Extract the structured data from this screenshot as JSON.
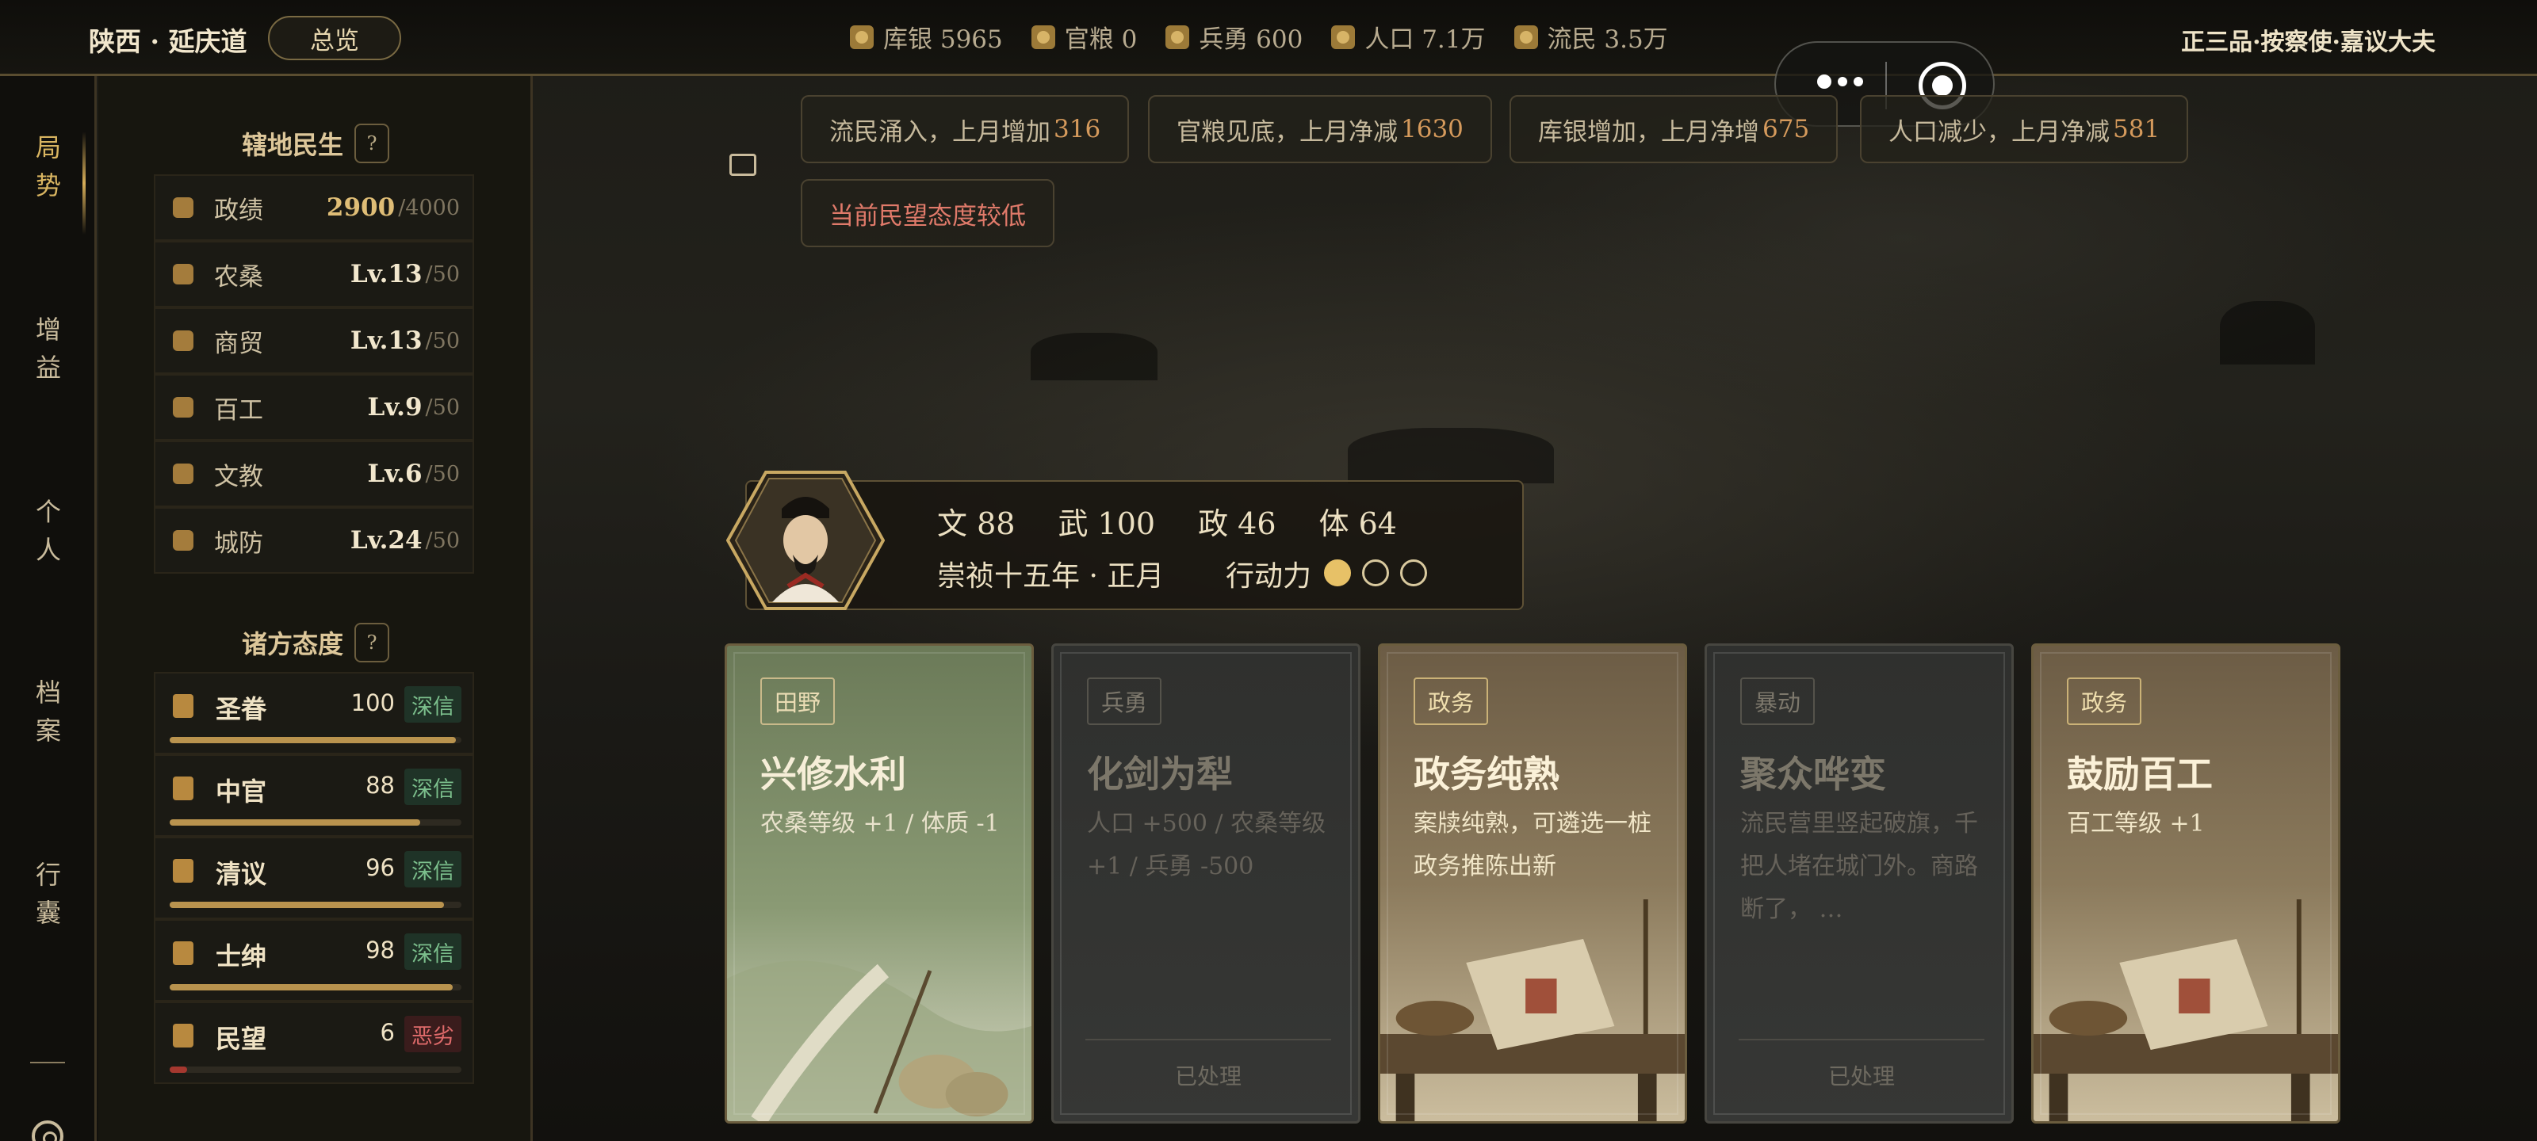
{
  "header": {
    "region": "陕西 · 延庆道",
    "overview_button": "总览",
    "rank": "正三品·按察使·嘉议大夫",
    "resources": [
      {
        "icon": "silver-icon",
        "text": "库银 5965"
      },
      {
        "icon": "grain-icon",
        "text": "官粮 0"
      },
      {
        "icon": "soldier-icon",
        "text": "兵勇 600"
      },
      {
        "icon": "population-icon",
        "text": "人口 7.1万"
      },
      {
        "icon": "refugee-icon",
        "text": "流民 3.5万"
      }
    ]
  },
  "nav": {
    "items": [
      {
        "line1": "局",
        "line2": "势",
        "active": true
      },
      {
        "line1": "增",
        "line2": "益"
      },
      {
        "line1": "个",
        "line2": "人"
      },
      {
        "line1": "档",
        "line2": "案"
      },
      {
        "line1": "行",
        "line2": "囊"
      }
    ]
  },
  "governance": {
    "title": "辖地民生",
    "help": "?",
    "stats": [
      {
        "icon": "merit-icon",
        "label": "政绩",
        "value": "2900",
        "max": "/4000"
      },
      {
        "icon": "farming-icon",
        "label": "农桑",
        "value": "Lv.13",
        "max": "/50"
      },
      {
        "icon": "trade-icon",
        "label": "商贸",
        "value": "Lv.13",
        "max": "/50"
      },
      {
        "icon": "crafts-icon",
        "label": "百工",
        "value": "Lv.9",
        "max": "/50"
      },
      {
        "icon": "education-icon",
        "label": "文教",
        "value": "Lv.6",
        "max": "/50"
      },
      {
        "icon": "defense-icon",
        "label": "城防",
        "value": "Lv.24",
        "max": "/50"
      }
    ]
  },
  "attitudes": {
    "title": "诸方态度",
    "help": "?",
    "items": [
      {
        "icon": "emperor-icon",
        "name": "圣眷",
        "value": "100",
        "badge": "深信",
        "level": 0.98,
        "tone": "good"
      },
      {
        "icon": "eunuch-icon",
        "name": "中官",
        "value": "88",
        "badge": "深信",
        "level": 0.86,
        "tone": "good"
      },
      {
        "icon": "scholar-icon",
        "name": "清议",
        "value": "96",
        "badge": "深信",
        "level": 0.94,
        "tone": "good"
      },
      {
        "icon": "gentry-icon",
        "name": "士绅",
        "value": "98",
        "badge": "深信",
        "level": 0.97,
        "tone": "good"
      },
      {
        "icon": "people-icon",
        "name": "民望",
        "value": "6",
        "badge": "恶劣",
        "level": 0.06,
        "tone": "bad"
      }
    ]
  },
  "notices": [
    {
      "text": "流民涌入，上月增加",
      "num": "316"
    },
    {
      "text": "官粮见底，上月净减",
      "num": "1630"
    },
    {
      "text": "库银增加，上月净增",
      "num": "675"
    },
    {
      "text": "人口减少，上月净减",
      "num": "581"
    },
    {
      "text": "当前民望态度较低",
      "num": ""
    }
  ],
  "character": {
    "stats": [
      "文 88",
      "武 100",
      "政 46",
      "体 64"
    ],
    "date": "崇祯十五年 · 正月",
    "ap_label": "行动力",
    "ap_filled": 1,
    "ap_total": 3
  },
  "cards": [
    {
      "tag": "田野",
      "title": "兴修水利",
      "desc": "农桑等级 +1 / 体质 -1",
      "done": "",
      "style": "green"
    },
    {
      "tag": "兵勇",
      "title": "化剑为犁",
      "desc": "人口 +500 / 农桑等级 +1 / 兵勇 -500",
      "done": "已处理",
      "style": "gray"
    },
    {
      "tag": "政务",
      "title": "政务纯熟",
      "desc": "案牍纯熟，可遴选一桩政务推陈出新",
      "done": "",
      "style": "tan"
    },
    {
      "tag": "暴动",
      "title": "聚众哗变",
      "desc": "流民营里竖起破旗，千把人堵在城门外。商路断了， …",
      "done": "已处理",
      "style": "gray"
    },
    {
      "tag": "政务",
      "title": "鼓励百工",
      "desc": "百工等级 +1",
      "done": "",
      "style": "tan"
    }
  ],
  "colors": {
    "gold": "#d9b561",
    "good": "#7cc08d",
    "bad": "#e06b6b",
    "notice_num": "#d59a5c"
  }
}
